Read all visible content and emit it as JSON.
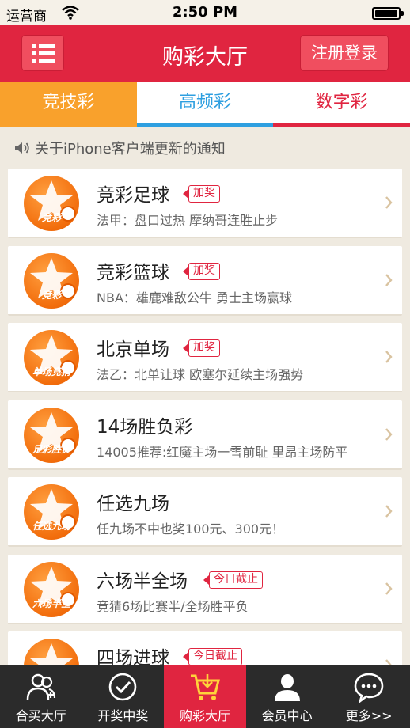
{
  "status_bar": {
    "carrier": "运营商",
    "time": "2:50 PM"
  },
  "header": {
    "title": "购彩大厅",
    "login_label": "注册登录"
  },
  "tabs": [
    {
      "label": "竞技彩",
      "active": true,
      "color": "#f9a12c"
    },
    {
      "label": "高频彩",
      "active": false,
      "color": "#2e9fe0"
    },
    {
      "label": "数字彩",
      "active": false,
      "color": "#e02540"
    }
  ],
  "notice": {
    "text": "关于iPhone客户端更新的通知"
  },
  "lotteries": [
    {
      "title": "竞彩足球",
      "badge": "加奖",
      "subtitle": "法甲：盘口过热 摩纳哥连胜止步",
      "logo_text": "竞彩",
      "icon": "football-lottery-icon"
    },
    {
      "title": "竞彩篮球",
      "badge": "加奖",
      "subtitle": "NBA：雄鹿难敌公牛  勇士主场赢球",
      "logo_text": "竞彩",
      "icon": "basketball-lottery-icon"
    },
    {
      "title": "北京单场",
      "badge": "加奖",
      "subtitle": "法乙：北单让球 欧塞尔延续主场强势",
      "logo_text": "单场竞猜",
      "icon": "beijing-single-icon"
    },
    {
      "title": "14场胜负彩",
      "badge": "",
      "subtitle": "14005推荐:红魔主场一雪前耻  里昂主场防平",
      "logo_text": "足彩胜负",
      "icon": "14-match-icon"
    },
    {
      "title": "任选九场",
      "badge": "",
      "subtitle": "任九场不中也奖100元、300元！",
      "logo_text": "任选九场",
      "icon": "pick-nine-icon"
    },
    {
      "title": "六场半全场",
      "badge": "今日截止",
      "subtitle": "竞猜6场比赛半/全场胜平负",
      "logo_text": "六场半全",
      "icon": "six-match-icon"
    },
    {
      "title": "四场进球",
      "badge": "今日截止",
      "subtitle": "",
      "logo_text": "",
      "icon": "four-goals-icon"
    }
  ],
  "tabbar": [
    {
      "label": "合买大厅",
      "icon": "group-buy-icon",
      "active": false
    },
    {
      "label": "开奖中奖",
      "icon": "check-circle-icon",
      "active": false
    },
    {
      "label": "购彩大厅",
      "icon": "shopping-cart-icon",
      "active": true
    },
    {
      "label": "会员中心",
      "icon": "user-icon",
      "active": false
    },
    {
      "label": "更多>>",
      "icon": "chat-more-icon",
      "active": false
    }
  ],
  "colors": {
    "brand_red": "#e02540",
    "orange": "#f9a12c",
    "blue": "#2e9fe0"
  }
}
